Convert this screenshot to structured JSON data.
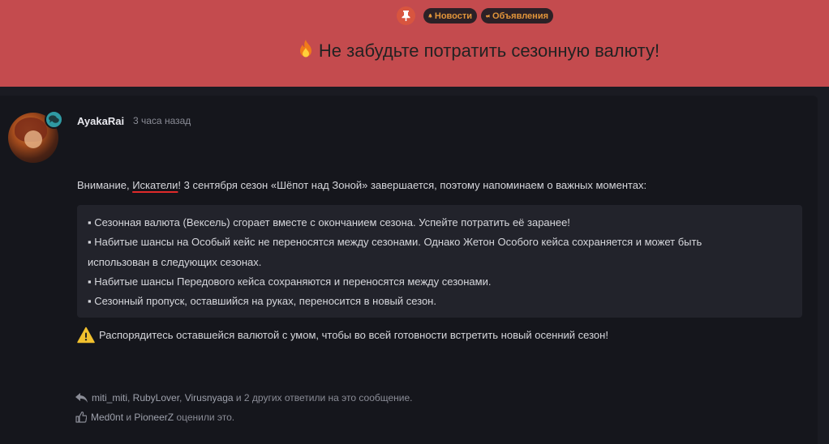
{
  "banner": {
    "tags": [
      {
        "label": "Новости",
        "icon": "bell-icon"
      },
      {
        "label": "Объявления",
        "icon": "megaphone-icon"
      }
    ],
    "title": "Не забудьте потратить сезонную валюту!",
    "color": "#c44b4e"
  },
  "post": {
    "author": "AyakaRai",
    "time": "3 часа назад",
    "intro_before": "Внимание, ",
    "intro_highlight": "Искатели",
    "intro_after": "! 3 сентября сезон «Шёпот над Зоной» завершается, поэтому напоминаем о важных моментах:",
    "quote_lines": [
      "▪ Сезонная валюта (Вексель) сгорает вместе с окончанием сезона. Успейте потратить её заранее!",
      "▪ Набитые шансы на Особый кейс не переносятся между сезонами. Однако Жетон Особого кейса сохраняется и может быть",
      "использован в следующих сезонах.",
      "▪ Набитые шансы Передового кейса сохраняются и переносятся между сезонами.",
      "▪ Сезонный пропуск, оставшийся на руках, переносится в новый сезон."
    ],
    "warning": "Распорядитесь оставшейся валютой с умом, чтобы во всей готовности встретить новый осенний сезон!"
  },
  "reactions": {
    "repliers": [
      "miti_miti",
      "RubyLover",
      "Virusnyaga"
    ],
    "replies_suffix": " и 2 других ответили на это сообщение.",
    "likers": [
      "Med0nt",
      "PioneerZ"
    ],
    "likes_joiner": " и ",
    "likes_suffix": " оценили это."
  }
}
